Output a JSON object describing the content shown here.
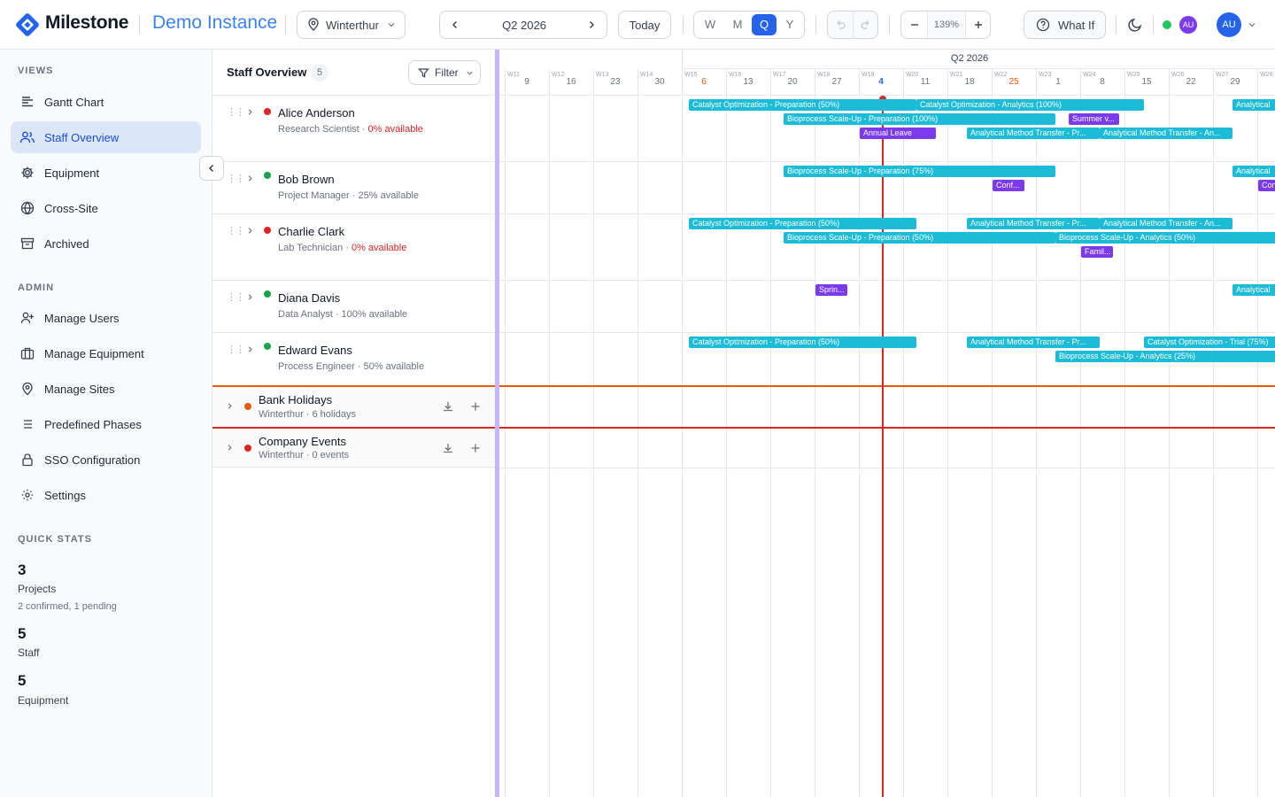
{
  "app": {
    "brand": "Milestone",
    "instance": "Demo Instance"
  },
  "header": {
    "location": "Winterthur",
    "period": "Q2 2026",
    "today_label": "Today",
    "view_modes": [
      "W",
      "M",
      "Q",
      "Y"
    ],
    "active_view": "Q",
    "zoom": "139%",
    "what_if_label": "What If",
    "presence_avatar": "AU",
    "user_avatar": "AU"
  },
  "sidebar": {
    "views_title": "VIEWS",
    "views": [
      {
        "label": "Gantt Chart",
        "icon": "gantt-icon"
      },
      {
        "label": "Staff Overview",
        "icon": "users-icon",
        "active": true
      },
      {
        "label": "Equipment",
        "icon": "gear-icon"
      },
      {
        "label": "Cross-Site",
        "icon": "globe-icon"
      },
      {
        "label": "Archived",
        "icon": "archive-icon"
      }
    ],
    "admin_title": "ADMIN",
    "admin": [
      {
        "label": "Manage Users",
        "icon": "user-plus-icon"
      },
      {
        "label": "Manage Equipment",
        "icon": "briefcase-icon"
      },
      {
        "label": "Manage Sites",
        "icon": "map-pin-icon"
      },
      {
        "label": "Predefined Phases",
        "icon": "list-icon"
      },
      {
        "label": "SSO Configuration",
        "icon": "lock-icon"
      },
      {
        "label": "Settings",
        "icon": "settings-icon"
      }
    ],
    "stats_title": "QUICK STATS",
    "stats": [
      {
        "value": "3",
        "label": "Projects",
        "sub": "2 confirmed, 1 pending"
      },
      {
        "value": "5",
        "label": "Staff",
        "sub": ""
      },
      {
        "value": "5",
        "label": "Equipment",
        "sub": ""
      }
    ]
  },
  "panel": {
    "title": "Staff Overview",
    "count": "5",
    "filter_label": "Filter",
    "staff": [
      {
        "name": "Alice Anderson",
        "role": "Research Scientist",
        "availability": "0% available",
        "status": "red"
      },
      {
        "name": "Bob Brown",
        "role": "Project Manager",
        "availability": "25% available",
        "status": "green"
      },
      {
        "name": "Charlie Clark",
        "role": "Lab Technician",
        "availability": "0% available",
        "status": "red"
      },
      {
        "name": "Diana Davis",
        "role": "Data Analyst",
        "availability": "100% available",
        "status": "green"
      },
      {
        "name": "Edward Evans",
        "role": "Process Engineer",
        "availability": "50% available",
        "status": "green"
      }
    ],
    "calendars": [
      {
        "name": "Bank Holidays",
        "sub": "Winterthur · 6 holidays",
        "color": "#ea580c"
      },
      {
        "name": "Company Events",
        "sub": "Winterthur · 0 events",
        "color": "#dc2626"
      }
    ]
  },
  "timeline": {
    "quarter_label": "Q2 2026",
    "weeks": [
      {
        "wk": "W11",
        "day": "9"
      },
      {
        "wk": "W12",
        "day": "16"
      },
      {
        "wk": "W13",
        "day": "23"
      },
      {
        "wk": "W14",
        "day": "30"
      },
      {
        "wk": "W15",
        "day": "6",
        "holiday": true
      },
      {
        "wk": "W16",
        "day": "13"
      },
      {
        "wk": "W17",
        "day": "20"
      },
      {
        "wk": "W18",
        "day": "27"
      },
      {
        "wk": "W19",
        "day": "4",
        "today": true
      },
      {
        "wk": "W20",
        "day": "11"
      },
      {
        "wk": "W21",
        "day": "18"
      },
      {
        "wk": "W22",
        "day": "25",
        "holiday": true
      },
      {
        "wk": "W23",
        "day": "1"
      },
      {
        "wk": "W24",
        "day": "8"
      },
      {
        "wk": "W25",
        "day": "15"
      },
      {
        "wk": "W26",
        "day": "22"
      },
      {
        "wk": "W27",
        "day": "29"
      },
      {
        "wk": "W28",
        "day": ""
      }
    ],
    "assignments": [
      {
        "row": 0,
        "lane": 0,
        "label": "Catalyst Optimization - Preparation (50%)",
        "color": "cyan"
      },
      {
        "row": 0,
        "lane": 0,
        "label": "Catalyst Optimization - Analytics (100%)",
        "color": "cyan"
      },
      {
        "row": 0,
        "lane": 0,
        "label": "Analytical",
        "color": "cyan"
      },
      {
        "row": 0,
        "lane": 1,
        "label": "Bioprocess Scale-Up - Preparation (100%)",
        "color": "cyan"
      },
      {
        "row": 0,
        "lane": 1,
        "label": "Summer v...",
        "color": "purple"
      },
      {
        "row": 0,
        "lane": 2,
        "label": "Annual Leave",
        "color": "purple"
      },
      {
        "row": 0,
        "lane": 2,
        "label": "Analytical Method Transfer - Pr...",
        "color": "cyan"
      },
      {
        "row": 0,
        "lane": 2,
        "label": "Analytical Method Transfer - An...",
        "color": "cyan"
      },
      {
        "row": 1,
        "lane": 0,
        "label": "Bioprocess Scale-Up - Preparation (75%)",
        "color": "cyan"
      },
      {
        "row": 1,
        "lane": 0,
        "label": "Analytical",
        "color": "cyan"
      },
      {
        "row": 1,
        "lane": 1,
        "label": "Conf...",
        "color": "purple"
      },
      {
        "row": 1,
        "lane": 1,
        "label": "Con",
        "color": "purple"
      },
      {
        "row": 2,
        "lane": 0,
        "label": "Catalyst Optimization - Preparation (50%)",
        "color": "cyan"
      },
      {
        "row": 2,
        "lane": 0,
        "label": "Analytical Method Transfer - Pr...",
        "color": "cyan"
      },
      {
        "row": 2,
        "lane": 0,
        "label": "Analytical Method Transfer - An...",
        "color": "cyan"
      },
      {
        "row": 2,
        "lane": 1,
        "label": "Bioprocess Scale-Up - Preparation (50%)",
        "color": "cyan"
      },
      {
        "row": 2,
        "lane": 1,
        "label": "Bioprocess Scale-Up - Analytics (50%)",
        "color": "cyan"
      },
      {
        "row": 2,
        "lane": 2,
        "label": "Famil...",
        "color": "purple"
      },
      {
        "row": 3,
        "lane": 0,
        "label": "Sprin...",
        "color": "purple"
      },
      {
        "row": 3,
        "lane": 0,
        "label": "Analytical",
        "color": "cyan"
      },
      {
        "row": 4,
        "lane": 0,
        "label": "Catalyst Optimization - Preparation (50%)",
        "color": "cyan"
      },
      {
        "row": 4,
        "lane": 0,
        "label": "Analytical Method Transfer - Pr...",
        "color": "cyan"
      },
      {
        "row": 4,
        "lane": 0,
        "label": "Catalyst Optimization - Trial (75%)",
        "color": "cyan"
      },
      {
        "row": 4,
        "lane": 1,
        "label": "Bioprocess Scale-Up - Analytics (25%)",
        "color": "cyan"
      }
    ]
  },
  "colors": {
    "accent": "#2563eb",
    "assignment": "#1cbcd8",
    "absence": "#7c3aed",
    "today": "#dc2626",
    "holiday": "#ea580c"
  }
}
